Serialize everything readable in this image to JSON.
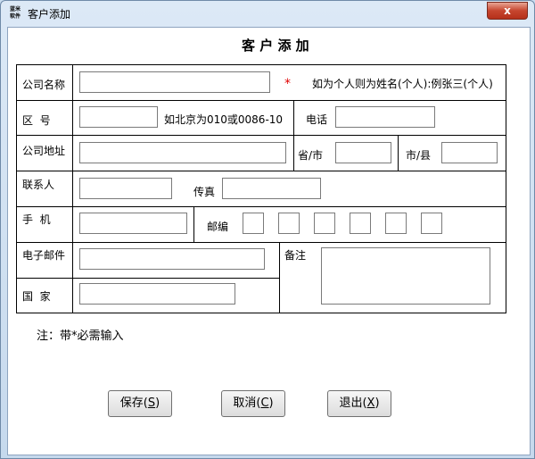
{
  "window": {
    "title": "客户添加",
    "logo_line1": "蓝米",
    "logo_line2": "软件",
    "close_label": "x"
  },
  "form": {
    "heading": "客 户 添 加",
    "company_name_label": "公司名称",
    "required_mark": "*",
    "company_name_hint": "如为个人则为姓名(个人):例张三(个人)",
    "area_code_label": "区  号",
    "area_code_hint": "如北京为010或0086-10",
    "phone_label": "电话",
    "address_label": "公司地址",
    "province_label": "省/市",
    "city_label": "市/县",
    "contact_label": "联系人",
    "fax_label": "传真",
    "mobile_label": "手  机",
    "postcode_label": "邮编",
    "email_label": "电子邮件",
    "remark_label": "备注",
    "country_label": "国  家",
    "note": "注：带*必需输入"
  },
  "buttons": {
    "save_text": "保存(",
    "save_key": "S",
    "cancel_text": "取消(",
    "cancel_key": "C",
    "exit_text": "退出(",
    "exit_key": "X",
    "close_paren": ")"
  }
}
